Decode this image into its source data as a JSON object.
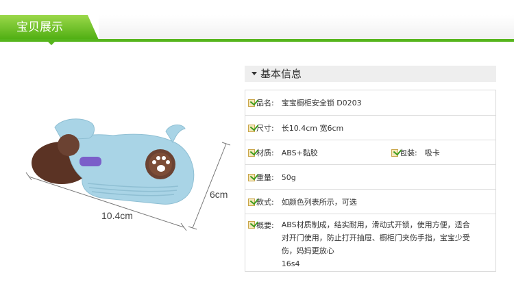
{
  "header": {
    "title": "宝贝展示"
  },
  "product_image": {
    "width_label": "10.4cm",
    "height_label": "6cm"
  },
  "info": {
    "section_title": "基本信息",
    "rows": [
      {
        "label": "品名:",
        "value": "宝宝橱柜安全锁 D0203"
      },
      {
        "label": "尺寸:",
        "value": "长10.4cm 宽6cm"
      },
      {
        "label": "材质:",
        "value": "ABS+黏胶",
        "label2": "包装:",
        "value2": "吸卡"
      },
      {
        "label": "重量:",
        "value": "50g"
      },
      {
        "label": "款式:",
        "value": "如颜色列表所示，可选"
      },
      {
        "label": "概要:",
        "lines": [
          "ABS材质制成，结实耐用，滑动式开锁，使用方便，适合",
          "对开门使用，防止打开抽屉、橱柜门夹伤手指，宝宝少受",
          "伤，妈妈更放心",
          "16s4"
        ]
      }
    ]
  },
  "colors": {
    "accent_green": "#56b51c",
    "product_blue": "#a9d4e6",
    "product_brown": "#6b4232",
    "button_purple": "#7b5ec9"
  }
}
